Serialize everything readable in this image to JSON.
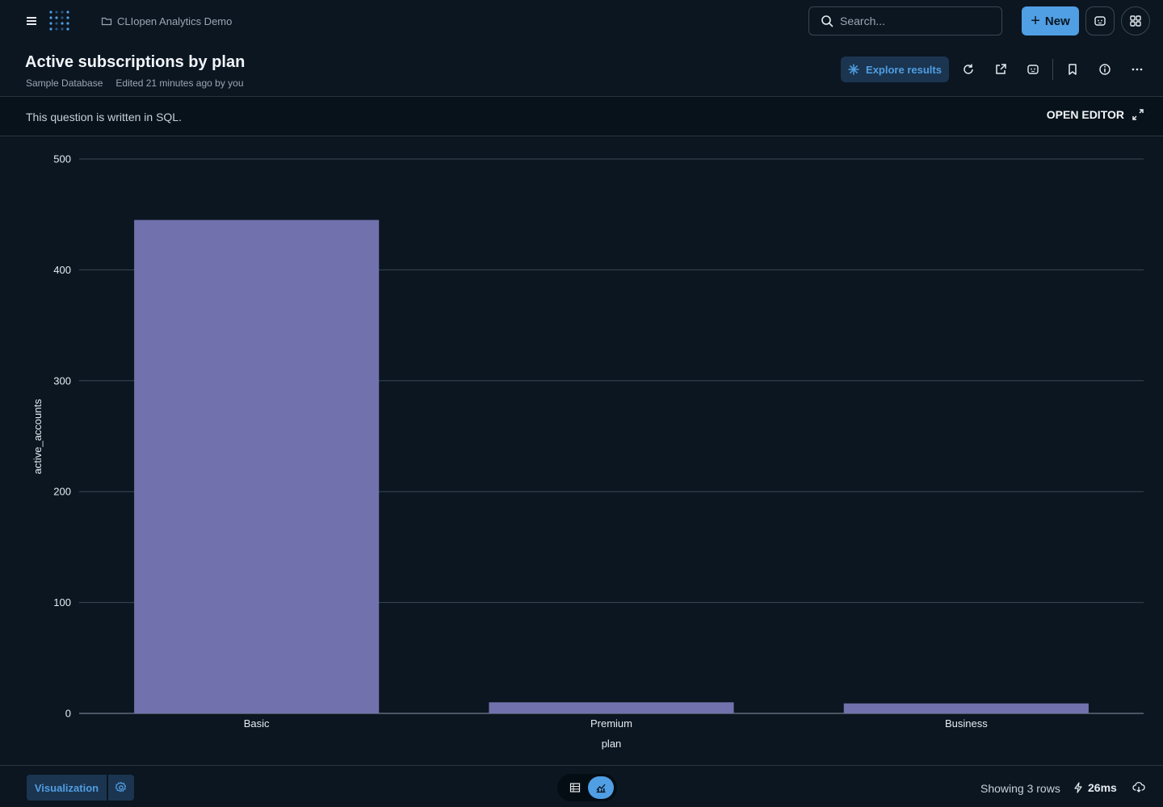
{
  "nav": {
    "breadcrumb": "CLIopen Analytics Demo",
    "search_placeholder": "Search...",
    "new_label": "New"
  },
  "header": {
    "title": "Active subscriptions by plan",
    "database": "Sample Database",
    "edited": "Edited 21 minutes ago by you",
    "explore_label": "Explore results"
  },
  "banner": {
    "text": "This question is written in SQL.",
    "open_editor_label": "OPEN EDITOR"
  },
  "chart_data": {
    "type": "bar",
    "categories": [
      "Basic",
      "Premium",
      "Business"
    ],
    "values": [
      445,
      10,
      9
    ],
    "xlabel": "plan",
    "ylabel": "active_accounts",
    "ylim": [
      0,
      500
    ],
    "yticks": [
      0,
      100,
      200,
      300,
      400,
      500
    ],
    "grid": true,
    "bar_color": "#7172ad"
  },
  "footer": {
    "visualization_label": "Visualization",
    "rows_text": "Showing 3 rows",
    "timing": "26ms"
  },
  "colors": {
    "background": "#0b1621",
    "accent": "#509ee3",
    "bar": "#7172ad",
    "gridline": "#3a4652"
  }
}
